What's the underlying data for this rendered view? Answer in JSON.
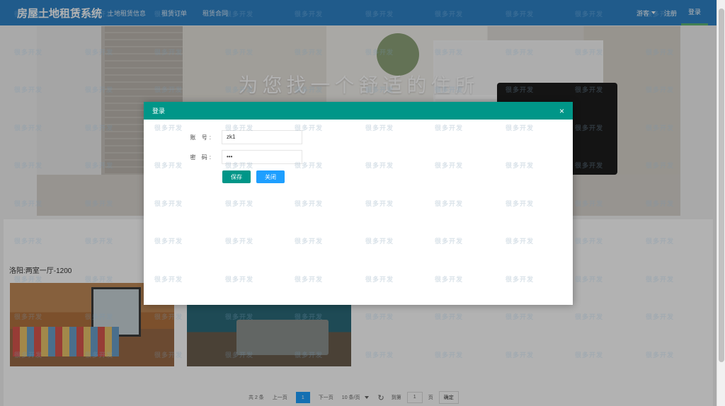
{
  "navbar": {
    "brand": "房屋土地租赁系统",
    "links": [
      "土地租赁信息",
      "租赁订单",
      "租赁合同"
    ],
    "guest_label": "游客",
    "register_label": "注册",
    "login_label": "登录"
  },
  "hero": {
    "title": "为您找一个舒适的住所"
  },
  "listing": {
    "title": "洛阳:两室一厅-1200"
  },
  "pagination": {
    "total": "共 2 条",
    "prev": "上一页",
    "current_page": "1",
    "next": "下一页",
    "page_size": "10 条/页",
    "goto_label": "到第",
    "goto_value": "1",
    "page_unit": "页",
    "confirm": "确定"
  },
  "modal": {
    "title": "登录",
    "close_symbol": "×",
    "account_label": "账 号:",
    "account_value": "zk1",
    "password_label": "密 码:",
    "password_value": "•••",
    "save_button": "保存",
    "close_button": "关闭"
  },
  "watermark": {
    "text": "很多开发"
  },
  "colors": {
    "navbar": "#2f83c7",
    "modal_header": "#009688",
    "save_button": "#009688",
    "close_button": "#1e9fff",
    "active_page": "#1e9fff"
  }
}
